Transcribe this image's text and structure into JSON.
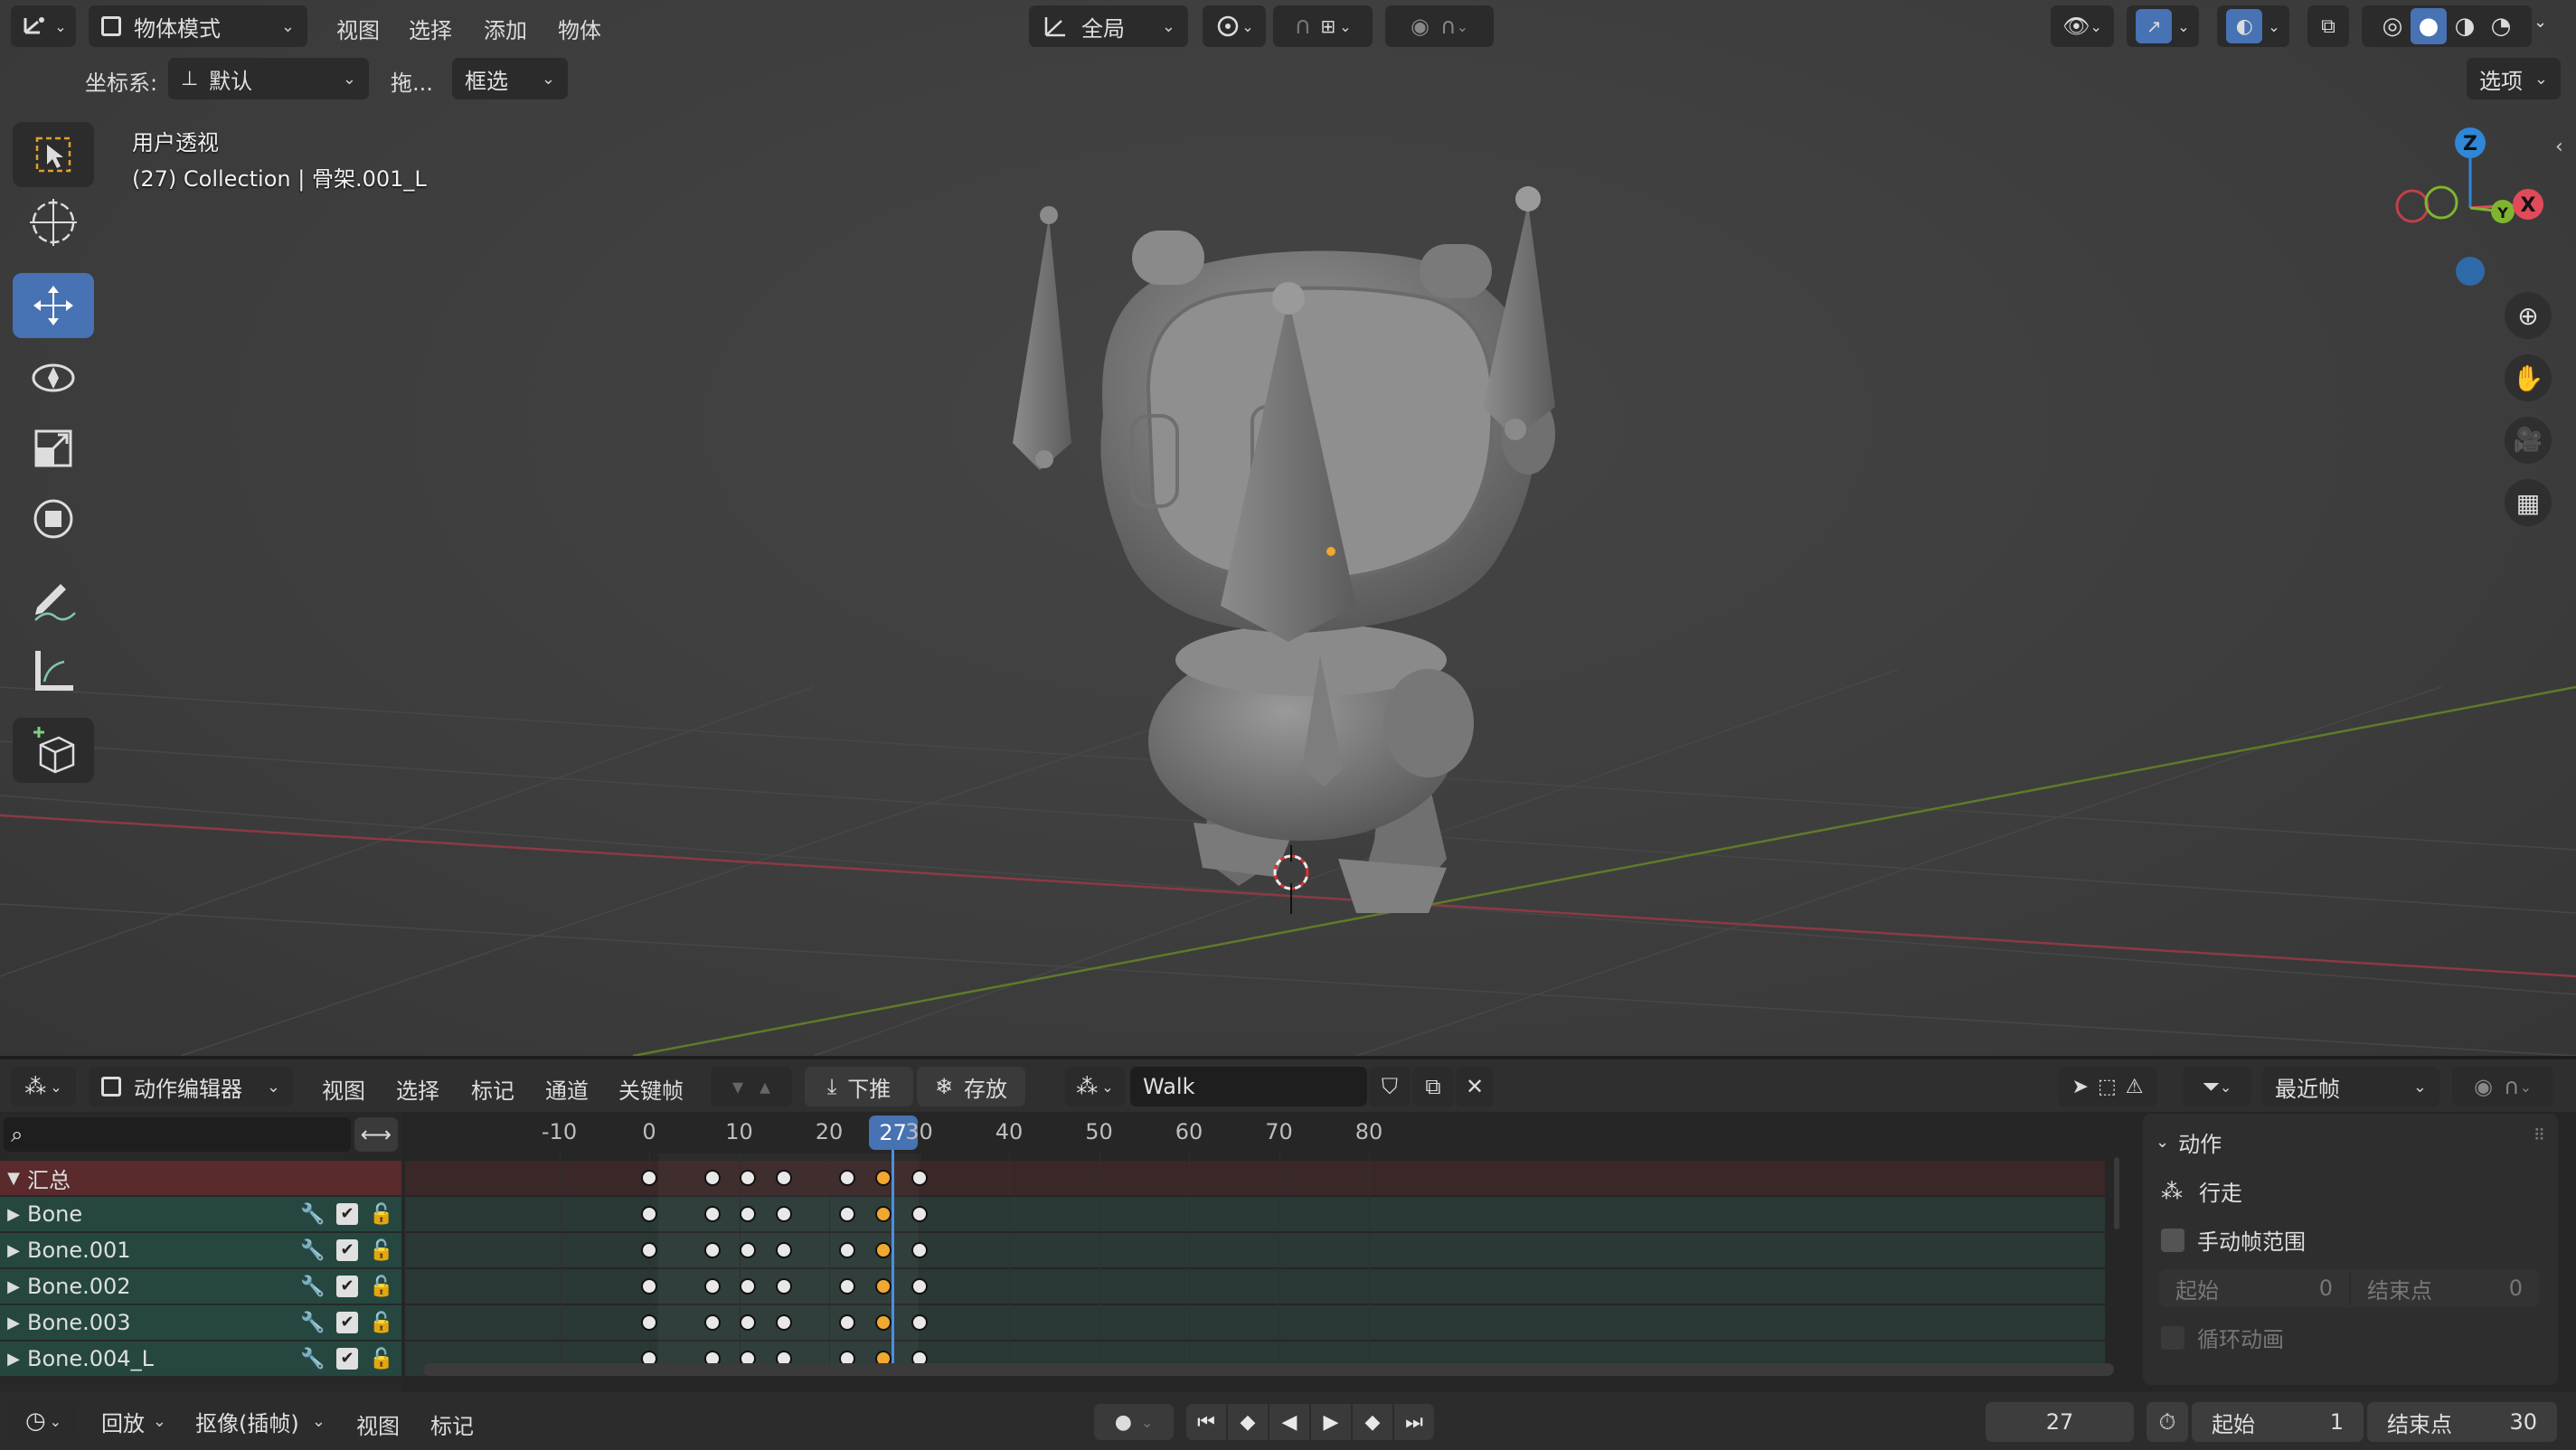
{
  "viewport_header": {
    "mode": "物体模式",
    "menus": [
      "视图",
      "选择",
      "添加",
      "物体"
    ],
    "orientation": "全局"
  },
  "tool_settings": {
    "coord_label": "坐标系:",
    "coord_value": "默认",
    "drag_label": "拖...",
    "select_mode": "框选",
    "options": "选项"
  },
  "viewport": {
    "view_name": "用户透视",
    "object_info": "(27) Collection | 骨架.001_L",
    "gizmo": {
      "z": "Z",
      "y": "Y",
      "x": "X"
    }
  },
  "toolbar": {
    "tools": [
      "select-box",
      "cursor",
      "move",
      "rotate",
      "scale",
      "transform",
      "annotate",
      "measure",
      "add-cube"
    ],
    "active": "move"
  },
  "action_editor": {
    "editor_type": "动作编辑器",
    "menus": [
      "视图",
      "选择",
      "标记",
      "通道",
      "关键帧"
    ],
    "push_down": "下推",
    "stash": "存放",
    "action_name": "Walk",
    "snap": "最近帧"
  },
  "timeline": {
    "ruler": [
      -10,
      0,
      10,
      20,
      30,
      40,
      50,
      60,
      70,
      80
    ],
    "current_frame": 27,
    "keyframes": [
      0,
      7,
      11,
      15,
      22,
      26,
      30
    ]
  },
  "channels": [
    {
      "name": "汇总",
      "summary": true
    },
    {
      "name": "Bone"
    },
    {
      "name": "Bone.001"
    },
    {
      "name": "Bone.002"
    },
    {
      "name": "Bone.003"
    },
    {
      "name": "Bone.004_L"
    }
  ],
  "side_panel": {
    "title": "动作",
    "action_label": "行走",
    "manual_range": "手动帧范围",
    "start_label": "起始",
    "start_value": "0",
    "end_label": "结束点",
    "end_value": "0",
    "cyclic": "循环动画"
  },
  "footer": {
    "playback": "回放",
    "keying": "抠像(插帧)",
    "view": "视图",
    "marker": "标记",
    "current_frame": "27",
    "start_label": "起始",
    "start_value": "1",
    "end_label": "结束点",
    "end_value": "30"
  },
  "colors": {
    "accent": "#4772b3",
    "keyframe_selected": "#f0a830",
    "channel_bg": "#254740",
    "summary_bg": "#5a2a2c",
    "x_axis": "#e04a5a",
    "y_axis": "#7fb52e",
    "z_axis": "#2f87d8"
  }
}
